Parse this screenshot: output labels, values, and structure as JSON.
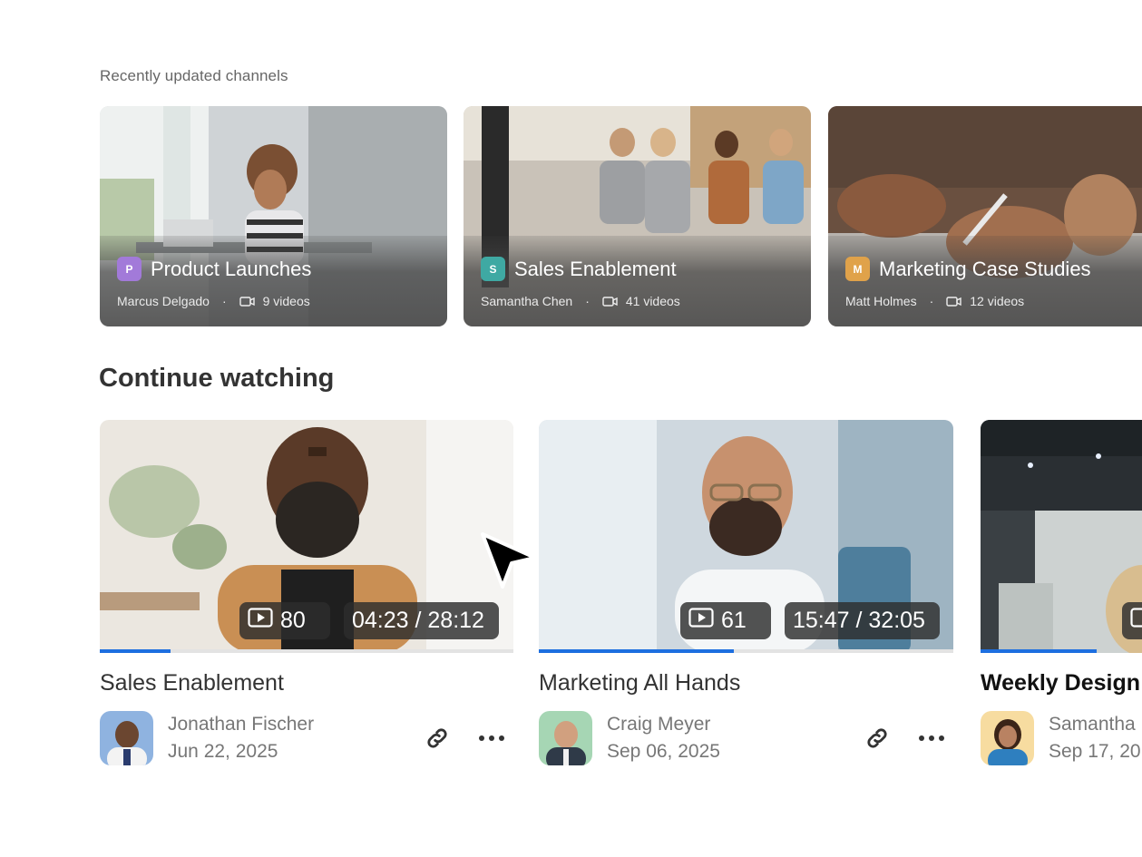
{
  "recent_channels": {
    "label": "Recently updated channels",
    "items": [
      {
        "badge": "P",
        "badge_color": "#a27ad9",
        "title": "Product Launches",
        "owner": "Marcus Delgado",
        "videos": "9 videos"
      },
      {
        "badge": "S",
        "badge_color": "#3fa9a3",
        "title": "Sales Enablement",
        "owner": "Samantha Chen",
        "videos": "41 videos"
      },
      {
        "badge": "M",
        "badge_color": "#e0a24a",
        "title": "Marketing Case Studies",
        "owner": "Matt Holmes",
        "videos": "12 videos"
      }
    ]
  },
  "continue_watching": {
    "heading": "Continue watching",
    "items": [
      {
        "title": "Sales Enablement",
        "views": "80",
        "time": "04:23 / 28:12",
        "progress": 0.17,
        "owner": "Jonathan Fischer",
        "date": "Jun 22, 2025"
      },
      {
        "title": "Marketing All Hands",
        "views": "61",
        "time": "15:47 / 32:05",
        "progress": 0.47,
        "owner": "Craig Meyer",
        "date": "Sep 06, 2025"
      },
      {
        "title": "Weekly Design",
        "views": "",
        "time": "",
        "progress": 0.28,
        "owner": "Samantha",
        "date": "Sep 17, 20"
      }
    ]
  },
  "icons": {
    "video": "video-camera-icon",
    "views": "play-icon",
    "link": "link-icon",
    "more": "more-icon",
    "cursor": "cursor-arrow-icon"
  },
  "colors": {
    "progress": "#1d6fe0",
    "pill": "#2d2d2d"
  }
}
